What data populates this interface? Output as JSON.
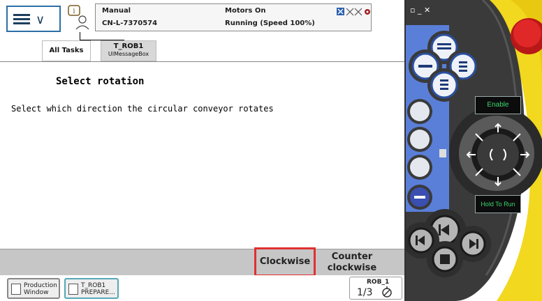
{
  "status": {
    "mode": "Manual",
    "system": "CN-L-7370574",
    "motors": "Motors On",
    "run_state": "Running (Speed 100%)"
  },
  "tabs": {
    "all_tasks": "All Tasks",
    "task_name": "T_ROB1",
    "task_sub": "UIMessageBox"
  },
  "message": {
    "title": "Select rotation",
    "body": "Select which direction the circular conveyor rotates"
  },
  "buttons": {
    "clockwise": "Clockwise",
    "counter_1": "Counter",
    "counter_2": "clockwise"
  },
  "taskbar": {
    "production_1": "Production",
    "production_2": "Window",
    "rob_1": "T_ROB1",
    "rob_2": "PREPARE...",
    "quickset_title": "ROB_1",
    "quickset_fraction": "1/3"
  },
  "pendant": {
    "enable": "Enable",
    "hold_to_run": "Hold To Run"
  },
  "colors": {
    "highlight": "#e03030",
    "pendant_blue": "#5a7fd8",
    "pendant_yellow": "#f0d820",
    "emergency_red": "#d82020"
  }
}
